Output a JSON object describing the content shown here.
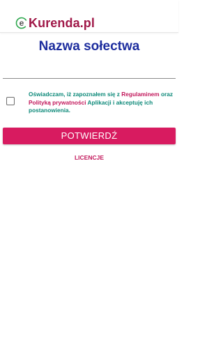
{
  "app": {
    "logo_prefix": "e",
    "logo_name": "Kurenda.pl"
  },
  "page": {
    "title": "Nazwa sołectwa"
  },
  "form": {
    "village_input_value": "",
    "consent": {
      "checked": false,
      "part1": "Oświadczam, iż zapoznałem się z ",
      "link_regulations": "Regulaminem",
      "part2": " oraz ",
      "link_privacy": "Polityką prywatności",
      "part3": " Aplikacji i akceptuję ich postanowienia."
    },
    "confirm_label": "POTWIERDŹ",
    "licenses_label": "LICENCJE"
  },
  "colors": {
    "accent": "#d81b60",
    "title": "#1d2d9e",
    "consent_text": "#0e8a7a",
    "link": "#c2185b"
  },
  "icons": {
    "logo": "ekurenda-logo-icon"
  }
}
